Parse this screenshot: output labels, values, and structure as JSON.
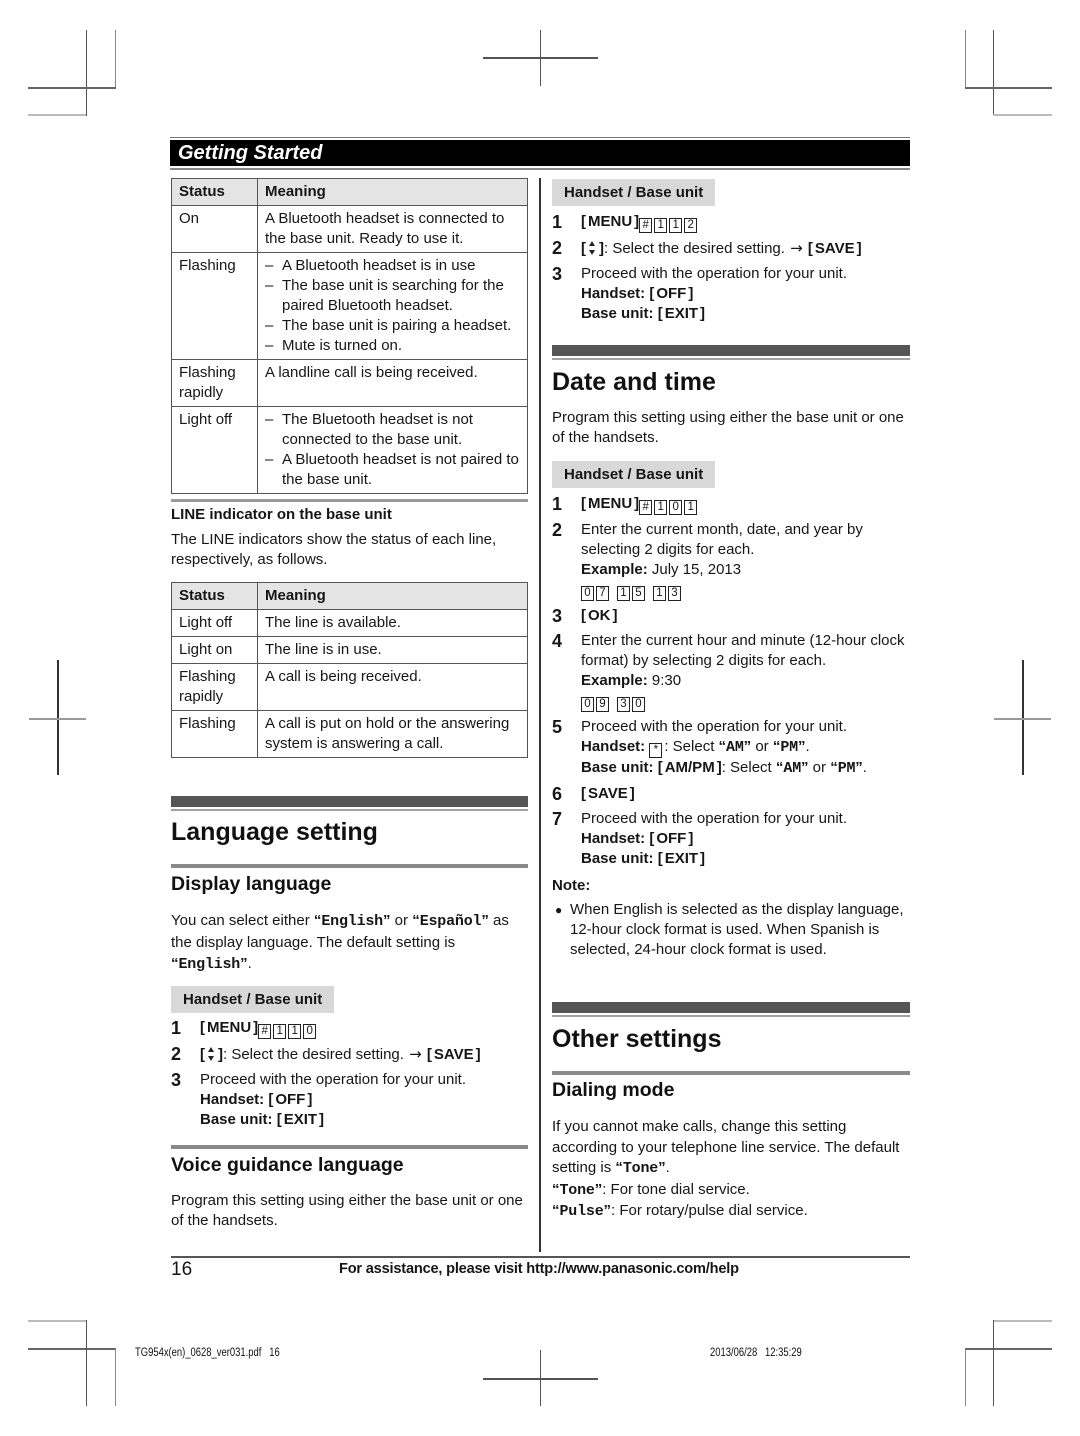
{
  "page_header": {
    "section_title": "Getting Started"
  },
  "bluetooth_table": {
    "headers": [
      "Status",
      "Meaning"
    ],
    "rows": [
      {
        "status": "On",
        "meaning": "A Bluetooth headset is connected to the base unit. Ready to use it."
      },
      {
        "status": "Flashing",
        "meaning_items": [
          "A Bluetooth headset is in use",
          "The base unit is searching for the paired Bluetooth headset.",
          "The base unit is pairing a headset.",
          "Mute is turned on."
        ]
      },
      {
        "status": "Flashing rapidly",
        "meaning": "A landline call is being received."
      },
      {
        "status": "Light off",
        "meaning_items": [
          "The Bluetooth headset is not connected to the base unit.",
          "A Bluetooth headset is not paired to the base unit."
        ]
      }
    ],
    "dash": "–"
  },
  "line_indicator": {
    "heading": "LINE indicator on the base unit",
    "description": "The LINE indicators show the status of each line, respectively, as follows.",
    "table": {
      "headers": [
        "Status",
        "Meaning"
      ],
      "rows": [
        {
          "status": "Light off",
          "meaning": "The line is available."
        },
        {
          "status": "Light on",
          "meaning": "The line is in use."
        },
        {
          "status": "Flashing rapidly",
          "meaning": "A call is being received."
        },
        {
          "status": "Flashing",
          "meaning": "A call is put on hold or the answering system is answering a call."
        }
      ]
    }
  },
  "language_setting": {
    "title": "Language setting",
    "display_language": {
      "heading": "Display language",
      "description": [
        "You can select either ",
        {
          "q": "“English”"
        },
        " or ",
        {
          "q": "“Español”"
        },
        " as the display language. The default setting is ",
        {
          "q": "“English”"
        },
        "."
      ],
      "unit_label": "Handset / Base unit",
      "steps": [
        {
          "num": "1",
          "lines": [
            [
              {
                "key": "MENU"
              },
              {
                "box": "#"
              },
              {
                "box": "1"
              },
              {
                "box": "1"
              },
              {
                "box": "0"
              }
            ]
          ]
        },
        {
          "num": "2",
          "lines": [
            [
              {
                "updown": true
              },
              ": Select the desired setting. ",
              {
                "arrow": "→"
              },
              " ",
              {
                "key": "SAVE"
              }
            ]
          ]
        },
        {
          "num": "3",
          "lines": [
            "Proceed with the operation for your unit.",
            [
              {
                "b": "Handset: "
              },
              {
                "key": "OFF"
              }
            ],
            [
              {
                "b": "Base unit: "
              },
              {
                "key": "EXIT"
              }
            ]
          ]
        }
      ]
    },
    "voice_guidance": {
      "heading": "Voice guidance language",
      "description": "Program this setting using either the base unit or one of the handsets.",
      "unit_label": "Handset / Base unit",
      "steps": [
        {
          "num": "1",
          "lines": [
            [
              {
                "key": "MENU"
              },
              {
                "box": "#"
              },
              {
                "box": "1"
              },
              {
                "box": "1"
              },
              {
                "box": "2"
              }
            ]
          ]
        },
        {
          "num": "2",
          "lines": [
            [
              {
                "updown": true
              },
              ": Select the desired setting. ",
              {
                "arrow": "→"
              },
              " ",
              {
                "key": "SAVE"
              }
            ]
          ]
        },
        {
          "num": "3",
          "lines": [
            "Proceed with the operation for your unit.",
            [
              {
                "b": "Handset: "
              },
              {
                "key": "OFF"
              }
            ],
            [
              {
                "b": "Base unit: "
              },
              {
                "key": "EXIT"
              }
            ]
          ]
        }
      ]
    }
  },
  "date_and_time": {
    "title": "Date and time",
    "description": "Program this setting using either the base unit or one of the handsets.",
    "unit_label": "Handset / Base unit",
    "steps": [
      {
        "num": "1",
        "lines": [
          [
            {
              "key": "MENU"
            },
            {
              "box": "#"
            },
            {
              "box": "1"
            },
            {
              "box": "0"
            },
            {
              "box": "1"
            }
          ]
        ]
      },
      {
        "num": "2",
        "lines": [
          "Enter the current month, date, and year by selecting 2 digits for each.",
          [
            {
              "b": "Example:"
            },
            " July 15, 2013"
          ],
          [
            {
              "box": "0"
            },
            {
              "box": "7"
            },
            {
              "gap": true
            },
            {
              "box": "1"
            },
            {
              "box": "5"
            },
            {
              "gap": true
            },
            {
              "box": "1"
            },
            {
              "box": "3"
            }
          ]
        ]
      },
      {
        "num": "3",
        "lines": [
          [
            {
              "key": "OK"
            }
          ]
        ]
      },
      {
        "num": "4",
        "lines": [
          "Enter the current hour and minute (12-hour clock format) by selecting 2 digits for each.",
          [
            {
              "b": "Example:"
            },
            " 9:30"
          ],
          [
            {
              "box": "0"
            },
            {
              "box": "9"
            },
            {
              "gap": true
            },
            {
              "box": "3"
            },
            {
              "box": "0"
            }
          ]
        ]
      },
      {
        "num": "5",
        "lines": [
          "Proceed with the operation for your unit.",
          [
            {
              "b": "Handset: "
            },
            {
              "box": "*",
              "icon": "key-star-icon"
            },
            ": Select ",
            {
              "q": "“AM”"
            },
            " or ",
            {
              "q": "“PM”"
            },
            "."
          ],
          [
            {
              "b": "Base unit: "
            },
            {
              "key": "AM/PM"
            },
            ": Select ",
            {
              "q": "“AM”"
            },
            " or ",
            {
              "q": "“PM”"
            },
            "."
          ]
        ]
      },
      {
        "num": "6",
        "lines": [
          [
            {
              "key": "SAVE"
            }
          ]
        ]
      },
      {
        "num": "7",
        "lines": [
          "Proceed with the operation for your unit.",
          [
            {
              "b": "Handset: "
            },
            {
              "key": "OFF"
            }
          ],
          [
            {
              "b": "Base unit: "
            },
            {
              "key": "EXIT"
            }
          ]
        ]
      }
    ],
    "note_label": "Note:",
    "notes": [
      "When English is selected as the display language, 12-hour clock format is used. When Spanish is selected, 24-hour clock format is used."
    ],
    "bullet": "●"
  },
  "other_settings": {
    "title": "Other settings",
    "dialing_mode": {
      "heading": "Dialing mode",
      "description": [
        "If you cannot make calls, change this setting according to your telephone line service. The default setting is ",
        {
          "q": "“Tone”"
        },
        "."
      ],
      "options": [
        [
          {
            "q": "“Tone”"
          },
          ": For tone dial service."
        ],
        [
          {
            "q": "“Pulse”"
          },
          ": For rotary/pulse dial service."
        ]
      ]
    }
  },
  "footer": {
    "page_number": "16",
    "assistance": "For assistance, please visit http://www.panasonic.com/help"
  },
  "print_info": {
    "file_and_page": "TG954x(en)_0628_ver031.pdf   16",
    "timestamp": "2013/06/28   12:35:29"
  }
}
